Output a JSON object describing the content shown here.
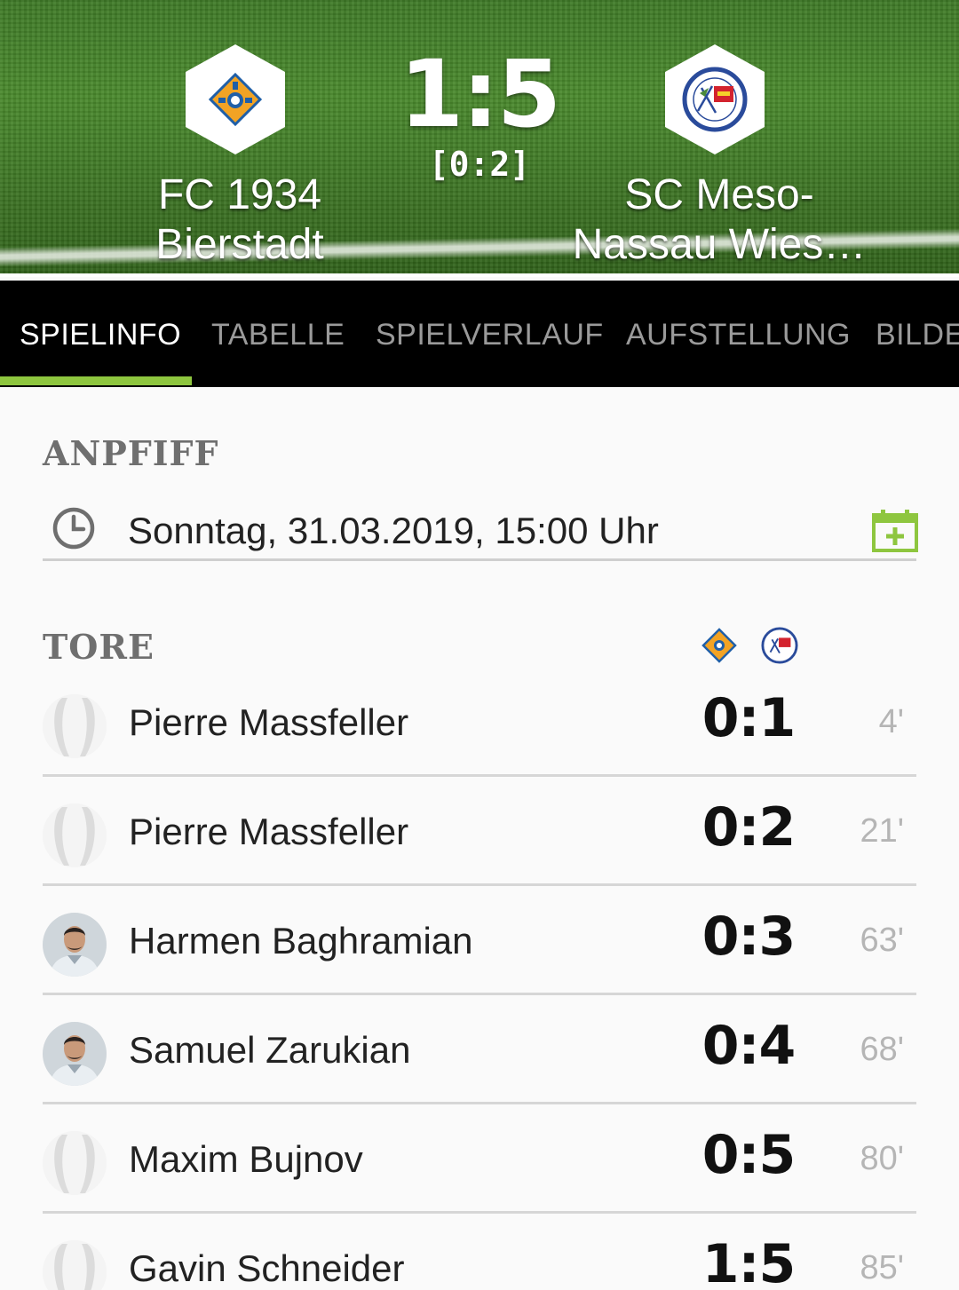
{
  "match": {
    "home_team": "FC 1934 Bierstadt",
    "away_team": "SC Meso-Nassau Wies…",
    "score": "1:5",
    "halftime": "[0:2]"
  },
  "tabs": [
    {
      "label": "SPIELINFO",
      "active": true
    },
    {
      "label": "TABELLE",
      "active": false
    },
    {
      "label": "SPIELVERLAUF",
      "active": false
    },
    {
      "label": "AUFSTELLUNG",
      "active": false
    },
    {
      "label": "BILDE",
      "active": false
    }
  ],
  "kickoff": {
    "title": "ANPFIFF",
    "datetime": "Sonntag, 31.03.2019, 15:00 Uhr"
  },
  "goals": {
    "title": "TORE",
    "items": [
      {
        "player": "Pierre Massfeller",
        "score": "0:1",
        "minute": "4'",
        "has_photo": false
      },
      {
        "player": "Pierre Massfeller",
        "score": "0:2",
        "minute": "21'",
        "has_photo": false
      },
      {
        "player": "Harmen Baghramian",
        "score": "0:3",
        "minute": "63'",
        "has_photo": true
      },
      {
        "player": "Samuel Zarukian",
        "score": "0:4",
        "minute": "68'",
        "has_photo": true
      },
      {
        "player": "Maxim Bujnov",
        "score": "0:5",
        "minute": "80'",
        "has_photo": false
      },
      {
        "player": "Gavin Schneider",
        "score": "1:5",
        "minute": "85'",
        "has_photo": false
      }
    ]
  },
  "colors": {
    "accent": "#8ec63f",
    "tab_bar": "#000000",
    "home_logo": "#f2a324",
    "away_logo": "#c81e2c"
  }
}
